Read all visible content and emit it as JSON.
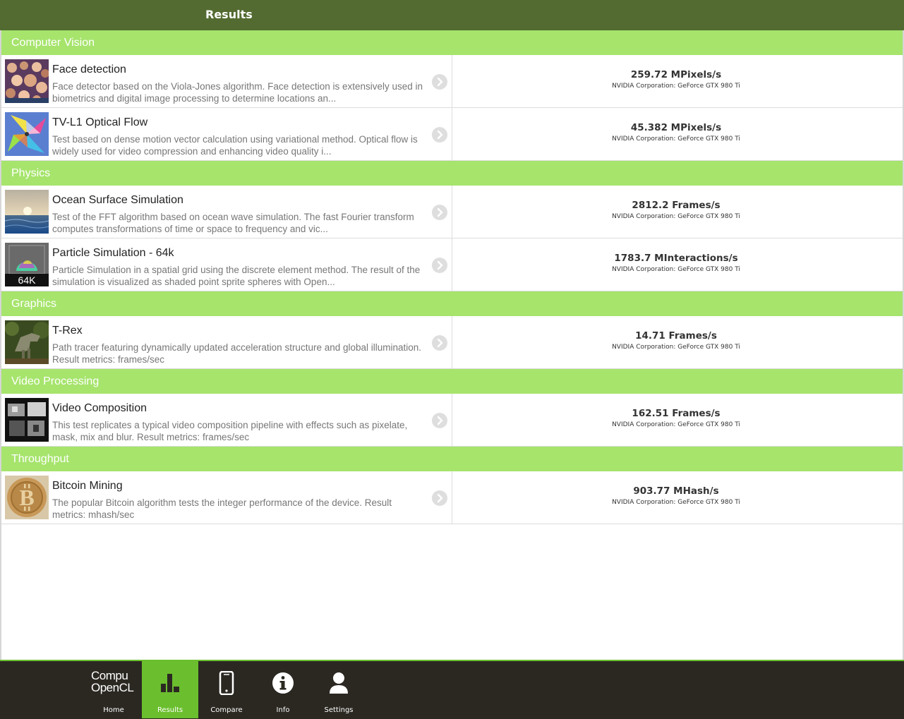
{
  "header": {
    "title": "Results"
  },
  "device_name": "NVIDIA Corporation: GeForce GTX 980 Ti",
  "categories": [
    {
      "name": "Computer Vision",
      "tests": [
        {
          "title": "Face detection",
          "desc1": "Face detector based on the Viola-Jones algorithm. Face detection is extensively used in",
          "desc2": "biometrics and digital image processing to determine locations an...",
          "score": "259.72 MPixels/s",
          "thumb_icon": "crowd-faces-thumbnail"
        },
        {
          "title": "TV-L1 Optical Flow",
          "desc1": "Test based on dense motion vector calculation using variational method. Optical flow is",
          "desc2": "widely used for video compression and enhancing video quality i...",
          "score": "45.382 MPixels/s",
          "thumb_icon": "pinwheel-thumbnail"
        }
      ]
    },
    {
      "name": "Physics",
      "tests": [
        {
          "title": "Ocean Surface Simulation",
          "desc1": "Test of the FFT algorithm based on ocean wave simulation. The fast Fourier transform",
          "desc2": "computes transformations of time or space to frequency and vic...",
          "score": "2812.2 Frames/s",
          "thumb_icon": "ocean-sunset-thumbnail"
        },
        {
          "title": "Particle Simulation - 64k",
          "desc1": "Particle Simulation in a spatial grid using the discrete element method. The result of the",
          "desc2": "simulation is visualized as shaded point sprite spheres with Open...",
          "score": "1783.7 MInteractions/s",
          "thumb_icon": "particle-sphere-thumbnail",
          "thumb_label": "64K"
        }
      ]
    },
    {
      "name": "Graphics",
      "tests": [
        {
          "title": "T-Rex",
          "desc1": "Path tracer featuring dynamically updated acceleration structure and global illumination.",
          "desc2": "Result metrics: frames/sec",
          "score": "14.71 Frames/s",
          "thumb_icon": "trex-thumbnail"
        }
      ]
    },
    {
      "name": "Video Processing",
      "tests": [
        {
          "title": "Video Composition",
          "desc1": "This test replicates a typical video composition pipeline with effects such as pixelate,",
          "desc2": "mask, mix and blur. Result metrics: frames/sec",
          "score": "162.51 Frames/s",
          "thumb_icon": "video-frames-thumbnail"
        }
      ]
    },
    {
      "name": "Throughput",
      "tests": [
        {
          "title": "Bitcoin Mining",
          "desc1": "The popular Bitcoin algorithm tests the integer performance of the device. Result",
          "desc2": "metrics: mhash/sec",
          "score": "903.77 MHash/s",
          "thumb_icon": "bitcoin-coin-thumbnail"
        }
      ]
    }
  ],
  "footer": {
    "logo_line1": "Compu",
    "logo_line2": "OpenCL",
    "items": [
      {
        "label": "Home",
        "icon": "compubench-logo"
      },
      {
        "label": "Results",
        "icon": "bar-chart-icon",
        "active": true
      },
      {
        "label": "Compare",
        "icon": "phone-icon"
      },
      {
        "label": "Info",
        "icon": "info-icon"
      },
      {
        "label": "Settings",
        "icon": "user-icon"
      }
    ]
  },
  "colors": {
    "header_bg": "#536b31",
    "category_bg": "#a6e46c",
    "footer_bg": "#2b2822",
    "accent": "#6bbf2e"
  }
}
